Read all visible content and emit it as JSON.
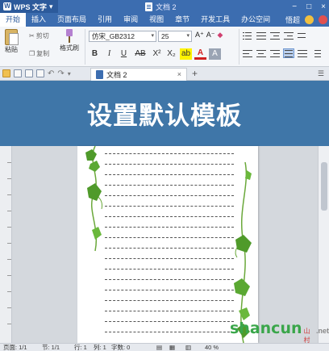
{
  "titlebar": {
    "app_name": "WPS 文字",
    "doc_title": "文档 2",
    "controls": [
      "−",
      "□",
      "×"
    ]
  },
  "menu": {
    "items": [
      "开始",
      "插入",
      "页面布局",
      "引用",
      "审阅",
      "视图",
      "章节",
      "开发工具",
      "办公空间"
    ],
    "active": "开始",
    "right_label": "悟超"
  },
  "ribbon": {
    "paste_label": "粘贴",
    "cut_label": "剪切",
    "copy_label": "复制",
    "format_painter_label": "格式刷",
    "font_name": "仿宋_GB2312",
    "font_size": "25",
    "format_buttons": [
      "B",
      "I",
      "U",
      "AB",
      "X²",
      "X₂",
      "ab",
      "A",
      "A"
    ],
    "grow_font": "A⁺",
    "shrink_font": "A⁻"
  },
  "tabbar": {
    "tab_label": "文档 2",
    "close": "×",
    "new_tab": "+"
  },
  "banner": {
    "text": "设置默认模板"
  },
  "statusbar": {
    "page": "页面: 1/1",
    "section": "节: 1/1",
    "row": "行: 1",
    "col": "列: 1",
    "words": "字数: 0",
    "zoom": "40 %"
  },
  "watermark": {
    "main": "shancun",
    "sub": "山村",
    "tld": ".net"
  },
  "colors": {
    "titlebar": "#3c6db0",
    "banner": "#3f76a8",
    "vine_green": "#4f9a2a"
  }
}
